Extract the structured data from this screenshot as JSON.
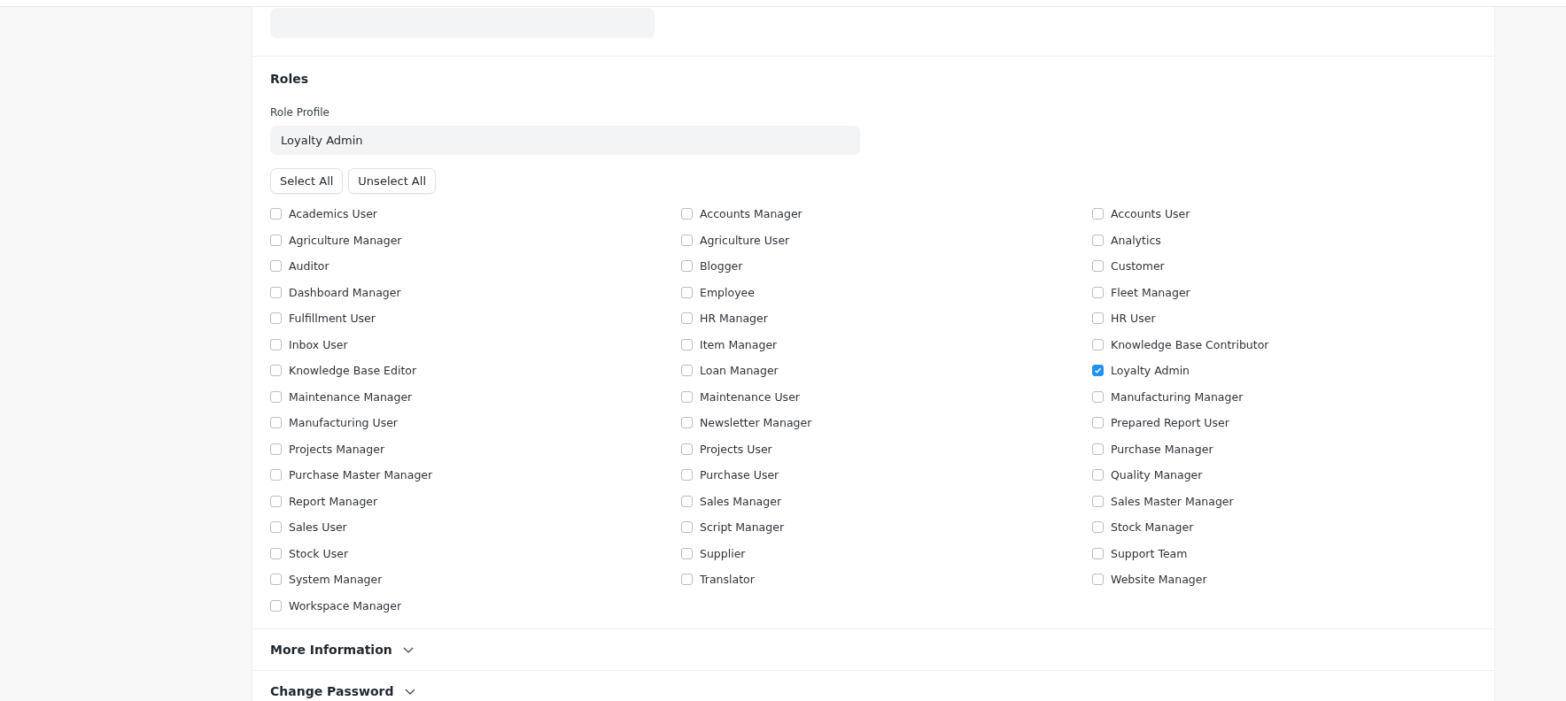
{
  "roles_section": {
    "title": "Roles",
    "role_profile": {
      "label": "Role Profile",
      "value": "Loyalty Admin"
    },
    "buttons": [
      "Select All",
      "Unselect All"
    ],
    "roles": [
      {
        "label": "Academics User",
        "checked": false
      },
      {
        "label": "Accounts Manager",
        "checked": false
      },
      {
        "label": "Accounts User",
        "checked": false
      },
      {
        "label": "Agriculture Manager",
        "checked": false
      },
      {
        "label": "Agriculture User",
        "checked": false
      },
      {
        "label": "Analytics",
        "checked": false
      },
      {
        "label": "Auditor",
        "checked": false
      },
      {
        "label": "Blogger",
        "checked": false
      },
      {
        "label": "Customer",
        "checked": false
      },
      {
        "label": "Dashboard Manager",
        "checked": false
      },
      {
        "label": "Employee",
        "checked": false
      },
      {
        "label": "Fleet Manager",
        "checked": false
      },
      {
        "label": "Fulfillment User",
        "checked": false
      },
      {
        "label": "HR Manager",
        "checked": false
      },
      {
        "label": "HR User",
        "checked": false
      },
      {
        "label": "Inbox User",
        "checked": false
      },
      {
        "label": "Item Manager",
        "checked": false
      },
      {
        "label": "Knowledge Base Contributor",
        "checked": false
      },
      {
        "label": "Knowledge Base Editor",
        "checked": false
      },
      {
        "label": "Loan Manager",
        "checked": false
      },
      {
        "label": "Loyalty Admin",
        "checked": true
      },
      {
        "label": "Maintenance Manager",
        "checked": false
      },
      {
        "label": "Maintenance User",
        "checked": false
      },
      {
        "label": "Manufacturing Manager",
        "checked": false
      },
      {
        "label": "Manufacturing User",
        "checked": false
      },
      {
        "label": "Newsletter Manager",
        "checked": false
      },
      {
        "label": "Prepared Report User",
        "checked": false
      },
      {
        "label": "Projects Manager",
        "checked": false
      },
      {
        "label": "Projects User",
        "checked": false
      },
      {
        "label": "Purchase Manager",
        "checked": false
      },
      {
        "label": "Purchase Master Manager",
        "checked": false
      },
      {
        "label": "Purchase User",
        "checked": false
      },
      {
        "label": "Quality Manager",
        "checked": false
      },
      {
        "label": "Report Manager",
        "checked": false
      },
      {
        "label": "Sales Manager",
        "checked": false
      },
      {
        "label": "Sales Master Manager",
        "checked": false
      },
      {
        "label": "Sales User",
        "checked": false
      },
      {
        "label": "Script Manager",
        "checked": false
      },
      {
        "label": "Stock Manager",
        "checked": false
      },
      {
        "label": "Stock User",
        "checked": false
      },
      {
        "label": "Supplier",
        "checked": false
      },
      {
        "label": "Support Team",
        "checked": false
      },
      {
        "label": "System Manager",
        "checked": false
      },
      {
        "label": "Translator",
        "checked": false
      },
      {
        "label": "Website Manager",
        "checked": false
      },
      {
        "label": "Workspace Manager",
        "checked": false
      }
    ]
  },
  "collapsed_sections": [
    {
      "title": "More Information",
      "expanded": false
    },
    {
      "title": "Change Password",
      "expanded": false
    }
  ]
}
